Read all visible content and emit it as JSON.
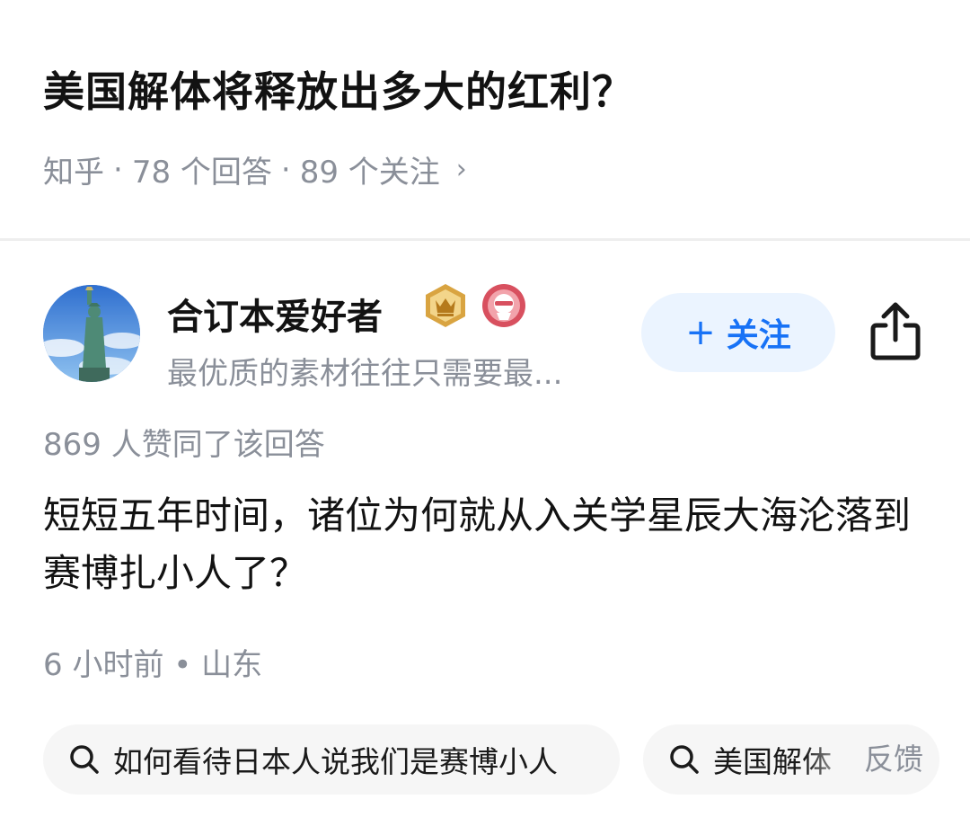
{
  "question": {
    "title": "美国解体将释放出多大的红利？",
    "source": "知乎",
    "answers": "78 个回答",
    "followers": "89 个关注",
    "separator": "·",
    "chevron": "›"
  },
  "author": {
    "name": "合订本爱好者",
    "bio": "最优质的素材往往只需要最...",
    "badges": [
      "crown-badge-icon",
      "red-emblem-icon"
    ],
    "follow_plus": "+",
    "follow_label": "关注"
  },
  "answer": {
    "likes": "869 人赞同了该回答",
    "text": "短短五年时间，诸位为何就从入关学星辰大海沦落到赛博扎小人了？",
    "time_location": "6 小时前 • 山东"
  },
  "related": {
    "items": [
      {
        "label": "如何看待日本人说我们是赛博小人",
        "icon": "search-icon"
      },
      {
        "label": "美国解体",
        "icon": "search-icon"
      }
    ],
    "feedback": "反馈"
  },
  "colors": {
    "accent": "#1772f6",
    "follow_bg": "#ebf4ff",
    "muted_text": "#8a8f99",
    "chip_bg": "#f6f6f6"
  }
}
